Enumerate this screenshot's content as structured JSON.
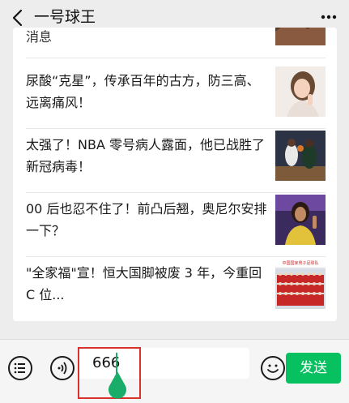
{
  "header": {
    "title": "一号球王"
  },
  "feed": {
    "clipped_text": "消息",
    "articles": [
      {
        "title": "尿酸“克星”，传承百年的古方，防三高、远离痛风！",
        "thumb": "woman-portrait"
      },
      {
        "title": "太强了！NBA 零号病人露面，他已战胜了新冠病毒！",
        "thumb": "basketball-game"
      },
      {
        "title": "00 后也忍不住了！前凸后翘，奥尼尔安排一下？",
        "thumb": "fan-in-stands"
      },
      {
        "title": "\"全家福\"宣！恒大国脚被废 3 年，今重回 C 位...",
        "thumb": "team-group-photo",
        "thumb_caption": "中国国家男子足球队"
      }
    ]
  },
  "composer": {
    "input_value": "666",
    "send_label": "发送"
  },
  "colors": {
    "accent": "#07c160",
    "highlight": "#d9312b",
    "handle": "#1aad6a"
  }
}
